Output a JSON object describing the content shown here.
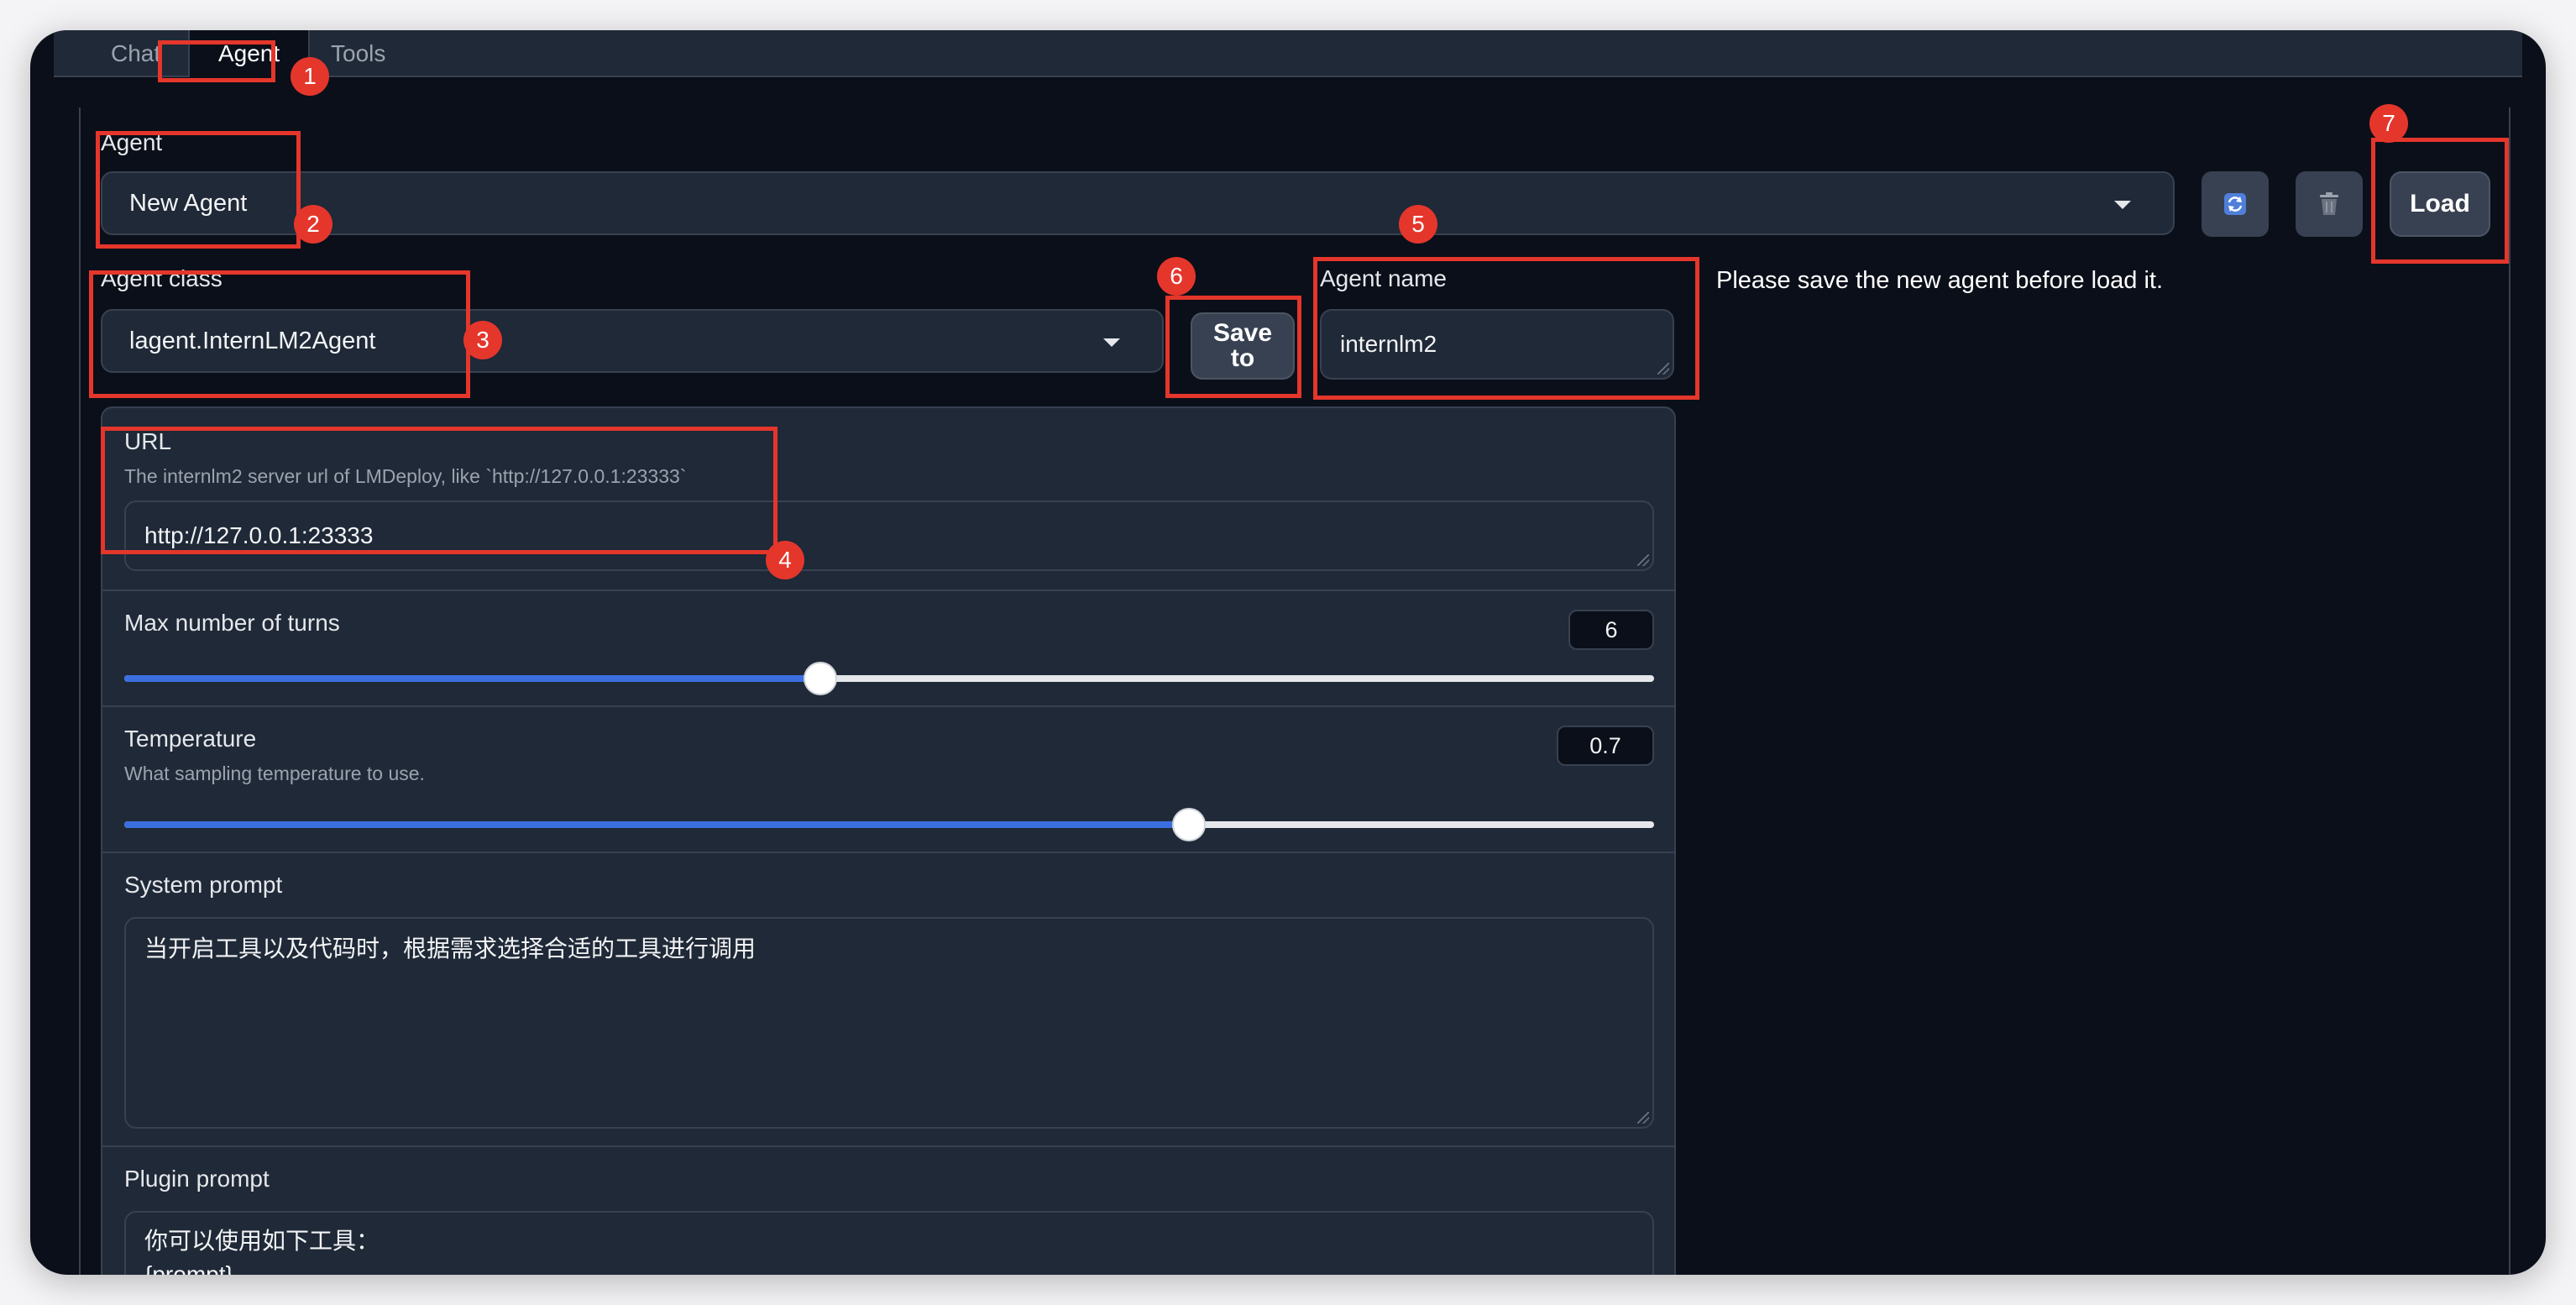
{
  "tabs": [
    {
      "label": "Chat"
    },
    {
      "label": "Agent"
    },
    {
      "label": "Tools"
    }
  ],
  "agent": {
    "label": "Agent",
    "selected": "New Agent",
    "refresh_icon": "refresh-icon",
    "delete_icon": "trash-icon",
    "load_label": "Load"
  },
  "agent_class": {
    "label": "Agent class",
    "selected": "lagent.InternLM2Agent",
    "save_label_line1": "Save",
    "save_label_line2": "to"
  },
  "agent_name": {
    "label": "Agent name",
    "value": "internlm2",
    "status": "Please save the new agent before load it."
  },
  "url": {
    "label": "URL",
    "info": "The internlm2 server url of LMDeploy, like `http://127.0.0.1:23333`",
    "value": "http://127.0.0.1:23333"
  },
  "max_turns": {
    "label": "Max number of turns",
    "value": "6",
    "fraction": 0.455
  },
  "temperature": {
    "label": "Temperature",
    "info": "What sampling temperature to use.",
    "value": "0.7",
    "fraction": 0.696
  },
  "system_prompt": {
    "label": "System prompt",
    "value": "当开启工具以及代码时，根据需求选择合适的工具进行调用"
  },
  "plugin_prompt": {
    "label": "Plugin prompt",
    "value": "你可以使用如下工具：\n{prompt}"
  },
  "markers": [
    "1",
    "2",
    "3",
    "4",
    "5",
    "6",
    "7"
  ],
  "colors": {
    "accent": "#3b6fe0",
    "annotation": "#e5362c",
    "background": "#0b0f19"
  }
}
